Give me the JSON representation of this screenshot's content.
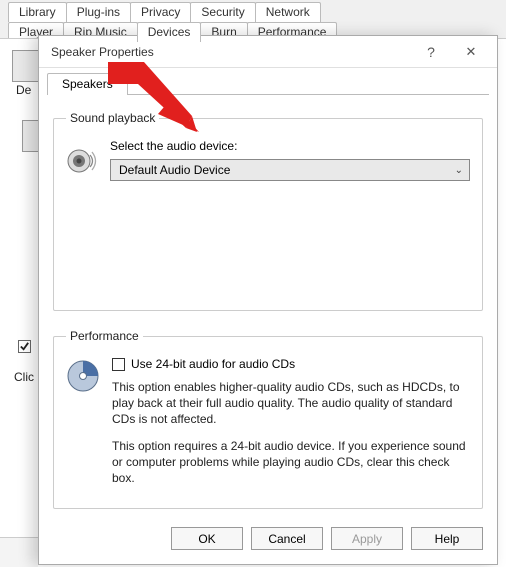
{
  "bg": {
    "tabs_row1": [
      "Library",
      "Plug-ins",
      "Privacy",
      "Security",
      "Network"
    ],
    "tabs_row2": [
      "Player",
      "Rip Music",
      "Devices",
      "Burn",
      "Performance"
    ],
    "active_tab_index_row2": 2,
    "devices_label": "De",
    "click_label": "Clic",
    "checkbox_checked": true
  },
  "dialog": {
    "title": "Speaker Properties",
    "help_glyph": "?",
    "close_glyph": "✕",
    "tab": "Speakers",
    "groups": {
      "sound": {
        "legend": "Sound playback",
        "select_label": "Select the audio device:",
        "select_value": "Default Audio Device"
      },
      "perf": {
        "legend": "Performance",
        "checkbox_label": "Use 24-bit audio for audio CDs",
        "para1": "This option enables higher-quality audio CDs, such as HDCDs, to play back at their full audio quality. The audio quality of standard CDs is not affected.",
        "para2": "This option requires a 24-bit audio device. If you experience sound or computer problems while playing audio CDs, clear this check box."
      }
    },
    "buttons": {
      "ok": "OK",
      "cancel": "Cancel",
      "apply": "Apply",
      "help": "Help"
    }
  },
  "annotation": {
    "arrow_color": "#e1201e"
  }
}
